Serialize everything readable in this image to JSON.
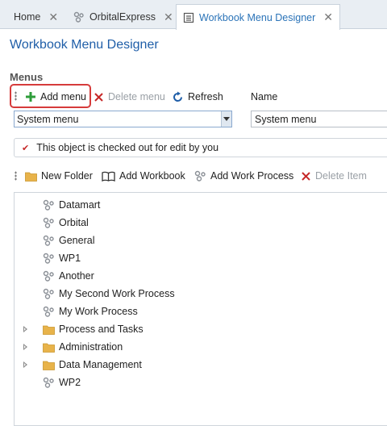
{
  "tabs": [
    {
      "label": "Home",
      "icon": "none"
    },
    {
      "label": "OrbitalExpress",
      "icon": "workprocess-icon"
    },
    {
      "label": "Workbook Menu Designer",
      "icon": "menu-designer-icon"
    }
  ],
  "page": {
    "title": "Workbook Menu Designer",
    "section": "Menus"
  },
  "menu_toolbar": {
    "add": "Add menu",
    "delete": "Delete menu",
    "refresh": "Refresh"
  },
  "name_label": "Name",
  "menu_select": {
    "value": "System menu"
  },
  "name_input": {
    "value": "System menu"
  },
  "notice": {
    "text": "This object is checked out for edit by you"
  },
  "tree_toolbar": {
    "new_folder": "New Folder",
    "add_workbook": "Add Workbook",
    "add_work_process": "Add Work Process",
    "delete_item": "Delete Item"
  },
  "tree": [
    {
      "label": "Datamart",
      "type": "workprocess"
    },
    {
      "label": "Orbital",
      "type": "workprocess"
    },
    {
      "label": "General",
      "type": "workprocess"
    },
    {
      "label": "WP1",
      "type": "workprocess"
    },
    {
      "label": "Another",
      "type": "workprocess"
    },
    {
      "label": "My Second Work Process",
      "type": "workprocess"
    },
    {
      "label": "My Work Process",
      "type": "workprocess"
    },
    {
      "label": "Process and Tasks",
      "type": "folder"
    },
    {
      "label": "Administration",
      "type": "folder"
    },
    {
      "label": "Data Management",
      "type": "folder"
    },
    {
      "label": "WP2",
      "type": "workprocess"
    }
  ],
  "colors": {
    "accent": "#1f5ea8",
    "highlight": "#d63b3b",
    "add": "#2e9d3a",
    "delete": "#c62828",
    "folder": "#e8b34a"
  }
}
